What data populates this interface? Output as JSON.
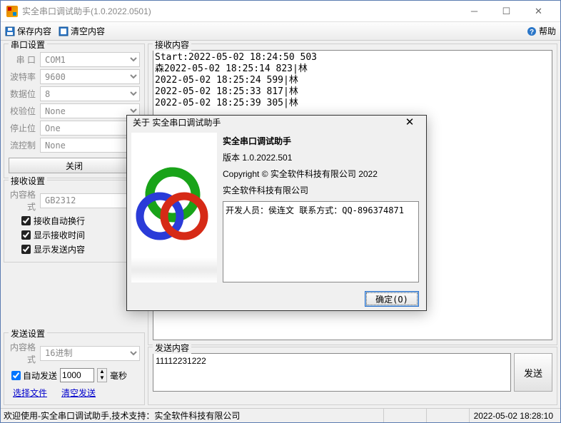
{
  "window": {
    "title": "实全串口调试助手(1.0.2022.0501)"
  },
  "toolbar": {
    "save": "保存内容",
    "clear": "清空内容",
    "help": "帮助"
  },
  "serial": {
    "title": "串口设置",
    "port_label": "串  口",
    "port_value": "COM1",
    "baud_label": "波特率",
    "baud_value": "9600",
    "data_label": "数据位",
    "data_value": "8",
    "parity_label": "校验位",
    "parity_value": "None",
    "stop_label": "停止位",
    "stop_value": "One",
    "flow_label": "流控制",
    "flow_value": "None",
    "close_btn": "关闭"
  },
  "recv_settings": {
    "title": "接收设置",
    "format_label": "内容格式",
    "format_value": "GB2312",
    "auto_wrap": "接收自动换行",
    "show_time": "显示接收时间",
    "show_send": "显示发送内容"
  },
  "send_settings": {
    "title": "发送设置",
    "format_label": "内容格式",
    "format_value": "16进制",
    "auto_send": "自动发送",
    "interval_value": "1000",
    "interval_unit": "毫秒",
    "select_file": "选择文件",
    "clear_send": "清空发送"
  },
  "recv": {
    "title": "接收内容",
    "lines": "Start:2022-05-02 18:24:50 503\n森2022-05-02 18:25:14 823|林\n2022-05-02 18:25:24 599|林\n2022-05-02 18:25:33 817|林\n2022-05-02 18:25:39 305|林"
  },
  "send": {
    "title": "发送内容",
    "value": "11112231222",
    "btn": "发送"
  },
  "status": {
    "main": "欢迎使用-实全串口调试助手,技术支持：实全软件科技有限公司",
    "time": "2022-05-02 18:28:10"
  },
  "about": {
    "title": "关于 实全串口调试助手",
    "app_name": "实全串口调试助手",
    "version": "版本 1.0.2022.501",
    "copyright": "Copyright © 实全软件科技有限公司 2022",
    "company": "实全软件科技有限公司",
    "detail": "开发人员：侯连文 联系方式：QQ-896374871",
    "ok": "确定(O)"
  }
}
